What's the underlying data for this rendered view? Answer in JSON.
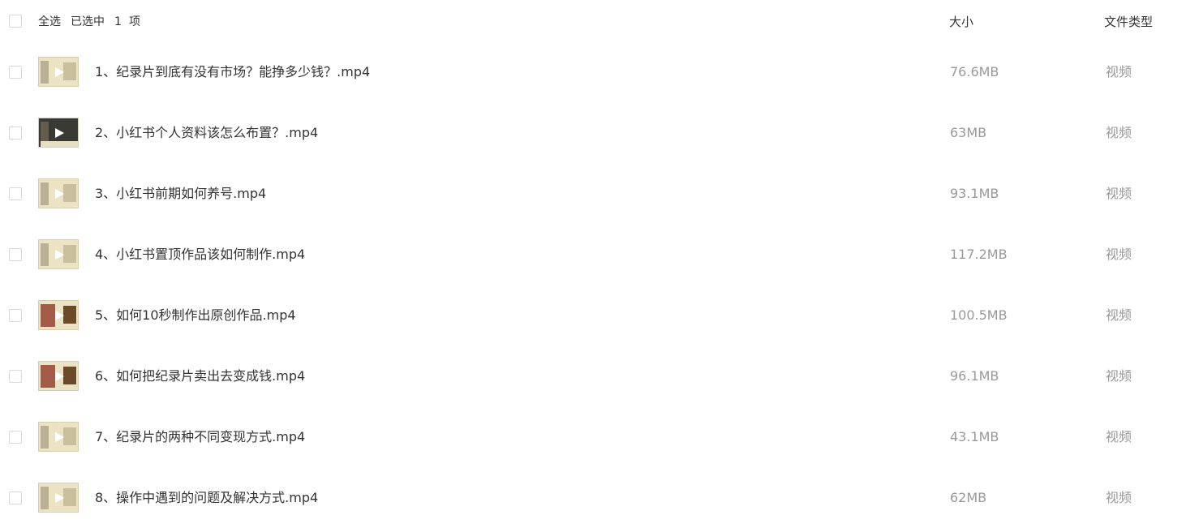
{
  "header": {
    "select_all": "全选",
    "selected_prefix": "已选中",
    "selected_count": "1",
    "selected_suffix": "项",
    "col_size": "大小",
    "col_type": "文件类型"
  },
  "files": [
    {
      "name": "1、纪录片到底有没有市场？能挣多少钱？.mp4",
      "size": "76.6MB",
      "type": "视频"
    },
    {
      "name": "2、小红书个人资料该怎么布置？.mp4",
      "size": "63MB",
      "type": "视频"
    },
    {
      "name": "3、小红书前期如何养号.mp4",
      "size": "93.1MB",
      "type": "视频"
    },
    {
      "name": "4、小红书置顶作品该如何制作.mp4",
      "size": "117.2MB",
      "type": "视频"
    },
    {
      "name": "5、如何10秒制作出原创作品.mp4",
      "size": "100.5MB",
      "type": "视频"
    },
    {
      "name": "6、如何把纪录片卖出去变成钱.mp4",
      "size": "96.1MB",
      "type": "视频"
    },
    {
      "name": "7、纪录片的两种不同变现方式.mp4",
      "size": "43.1MB",
      "type": "视频"
    },
    {
      "name": "8、操作中遇到的问题及解决方式.mp4",
      "size": "62MB",
      "type": "视频"
    }
  ],
  "icons": {
    "checkbox": "checkbox-unchecked-icon",
    "thumbnail": "video-thumbnail-play-icon"
  },
  "colors": {
    "text_primary": "#333333",
    "text_secondary": "#999999",
    "checkbox_border": "#d9d9d9"
  }
}
